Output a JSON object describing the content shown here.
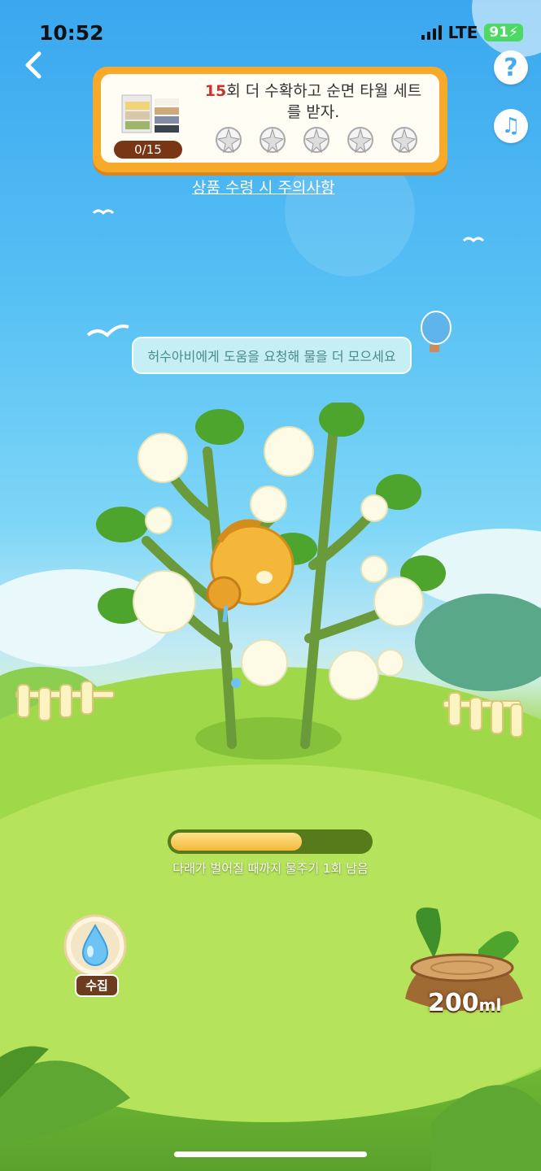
{
  "status_bar": {
    "time": "10:52",
    "network": "LTE",
    "battery": "91"
  },
  "reward": {
    "count_prefix": "15",
    "message_rest": "회 더 수확하고 순면 타월 세트를 받자.",
    "progress_label": "0/15",
    "slots": 5
  },
  "notice_link": "상품 수령 시 주의사항",
  "hint": "허수아비에게 도움을 요청해 물을 더 모으세요",
  "growth": {
    "progress": 0.66,
    "caption": "다래가 벌어질 때까지 물주기 1회 남음"
  },
  "collect": {
    "label": "수집"
  },
  "water": {
    "amount": "200",
    "unit": "ml"
  },
  "icons": [
    "back-icon",
    "help-icon",
    "music-note-icon",
    "cotton-flower-icon",
    "water-drop-icon",
    "watering-can-icon"
  ]
}
